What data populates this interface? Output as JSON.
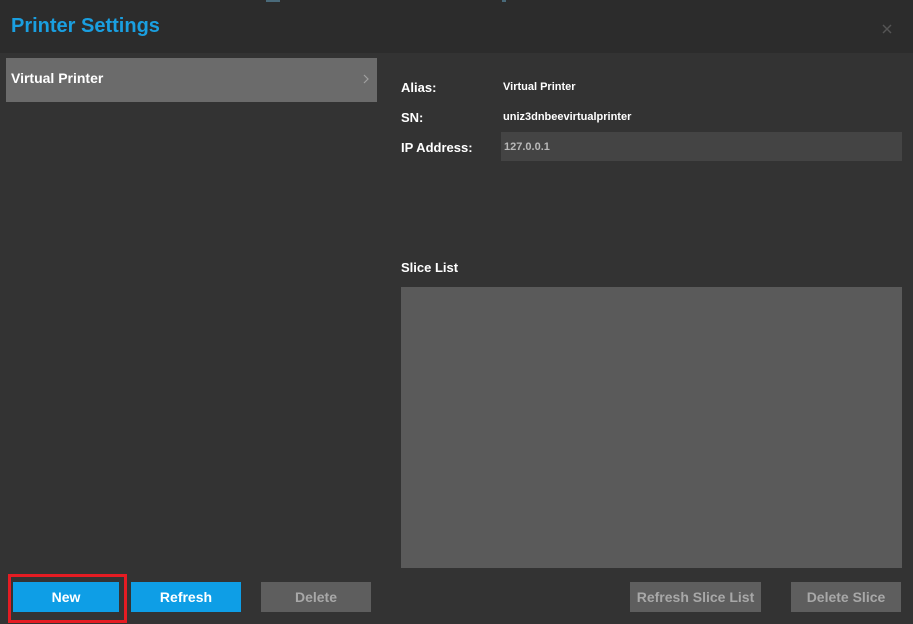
{
  "window": {
    "title": "Printer Settings",
    "accent_color": "#1a9fe0"
  },
  "printer_list": {
    "items": [
      {
        "label": "Virtual Printer",
        "selected": true
      }
    ]
  },
  "details": {
    "alias_label": "Alias:",
    "alias_value": "Virtual Printer",
    "sn_label": "SN:",
    "sn_value": "uniz3dnbeevirtualprinter",
    "ip_label": "IP Address:",
    "ip_value": "127.0.0.1"
  },
  "slice_list": {
    "title": "Slice List",
    "items": []
  },
  "buttons": {
    "new": "New",
    "refresh": "Refresh",
    "delete": "Delete",
    "refresh_slice_list": "Refresh Slice List",
    "delete_slice": "Delete Slice"
  },
  "colors": {
    "primary_button": "#0e9ee6",
    "disabled_button": "#5e5e5e",
    "highlight": "#e51c23"
  }
}
